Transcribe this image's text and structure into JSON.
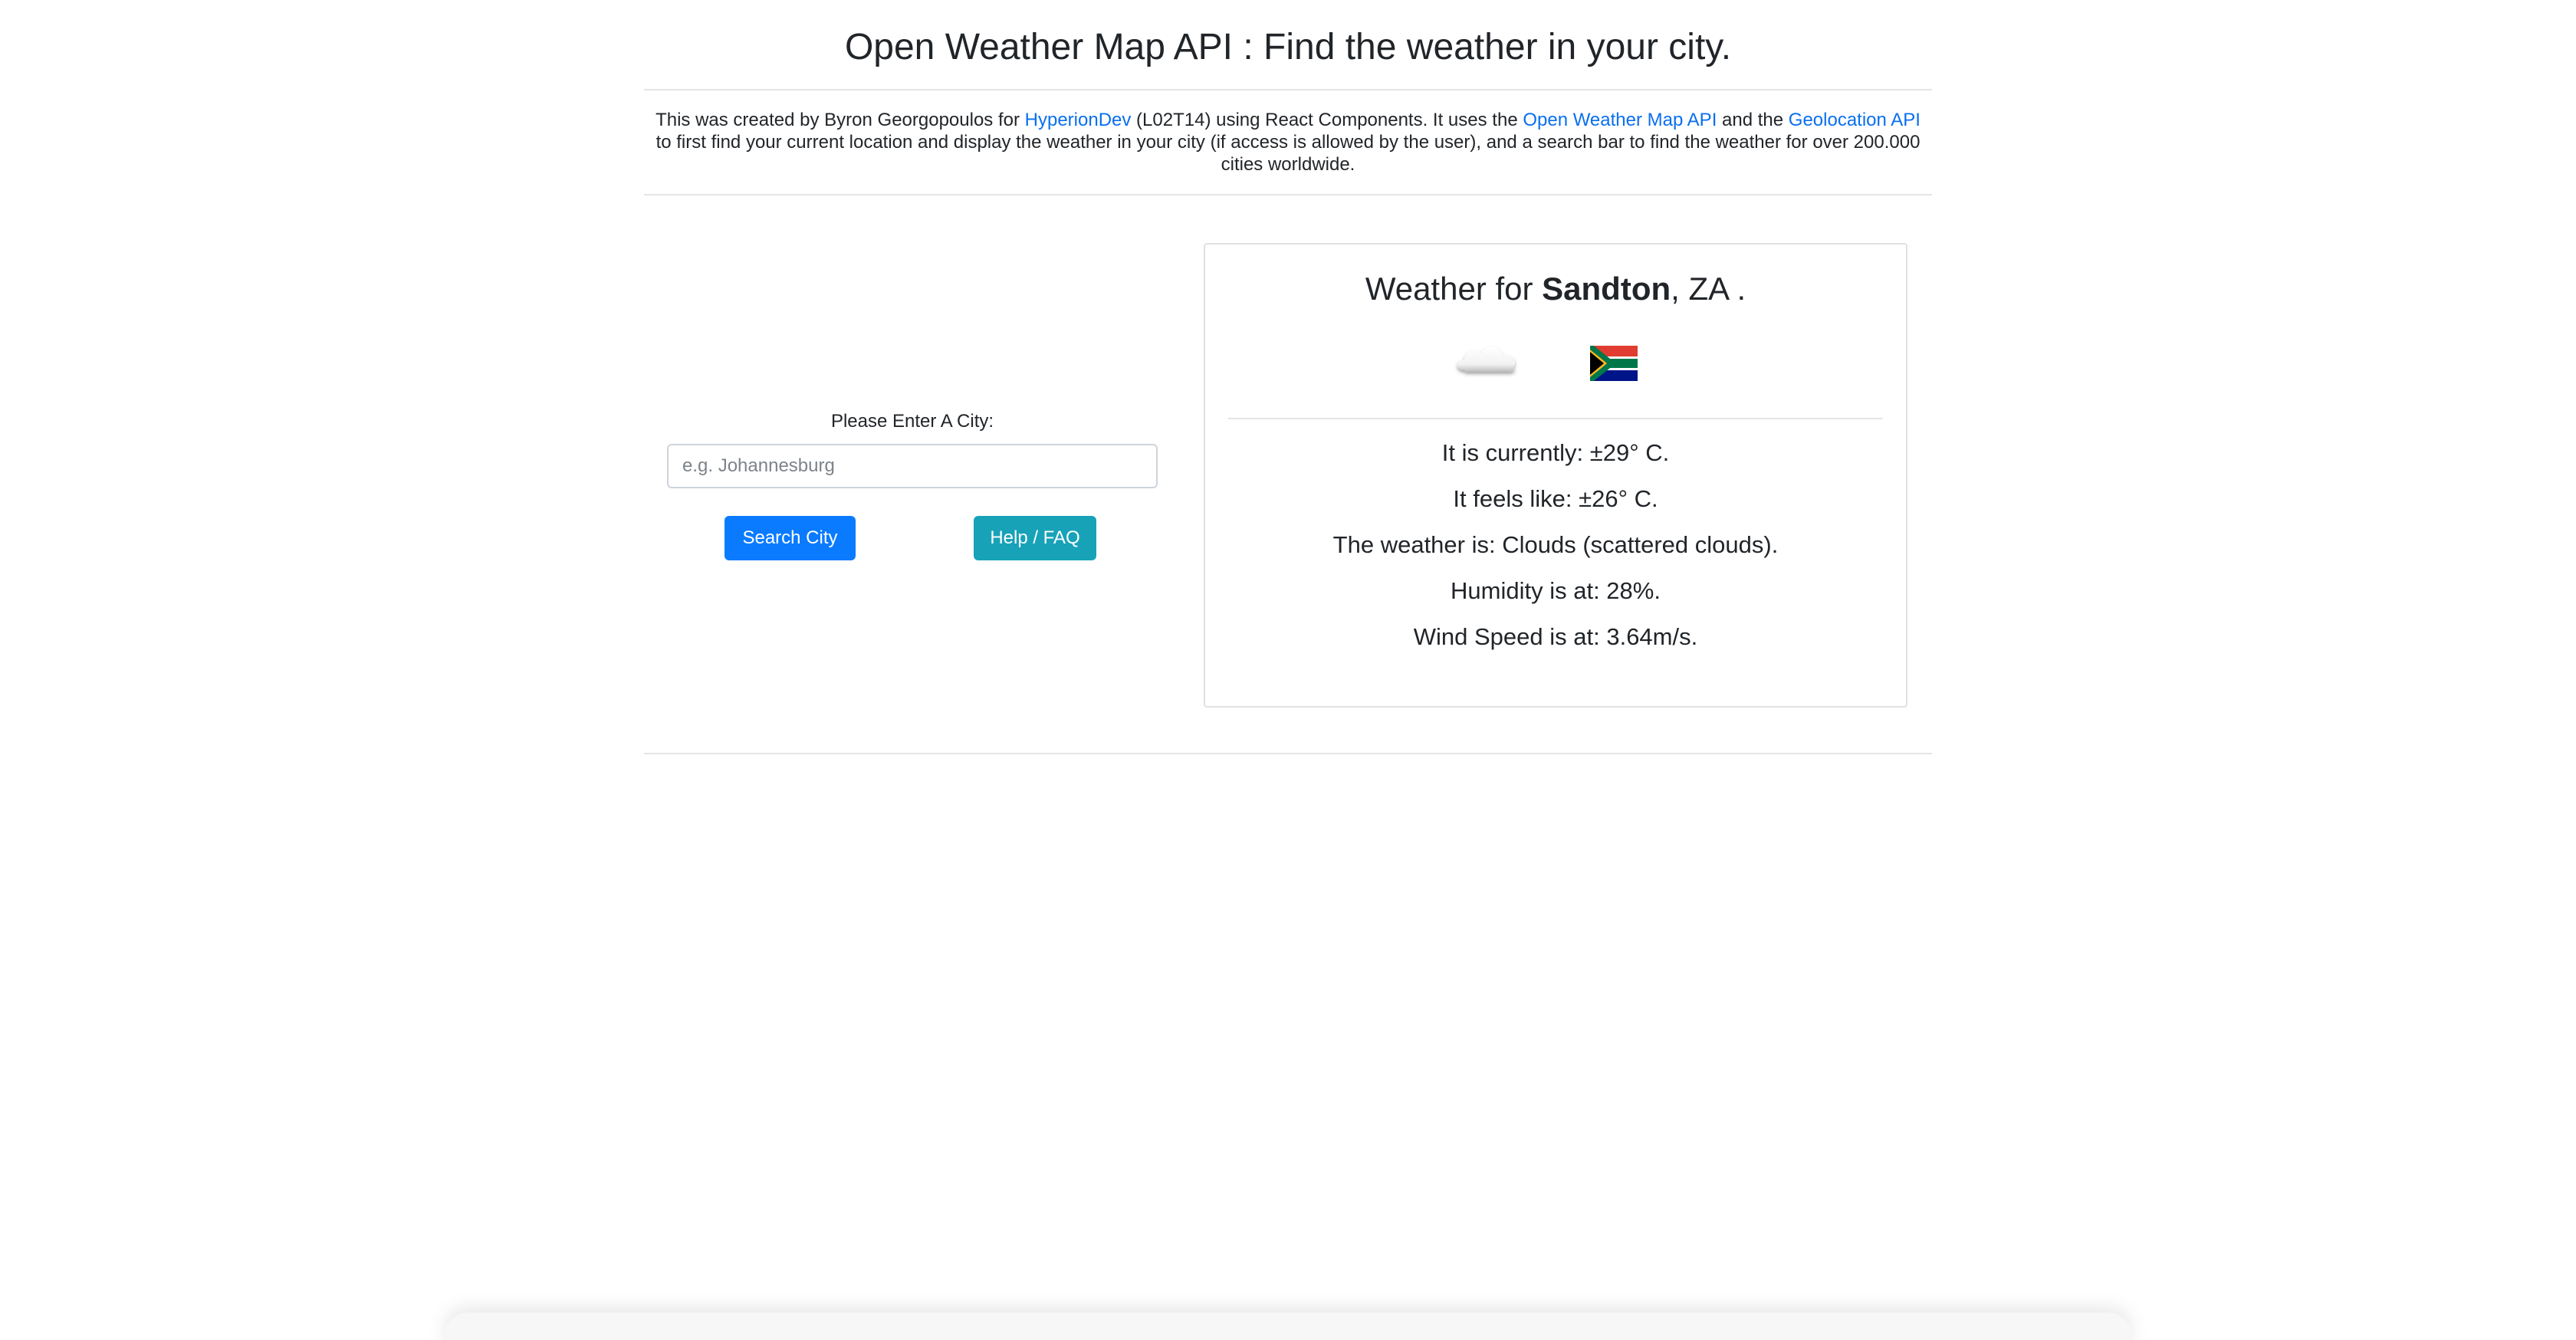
{
  "header": {
    "title": "Open Weather Map API : Find the weather in your city."
  },
  "intro": {
    "part1": "This was created by Byron Georgopoulos for ",
    "link_hyperiondev": "HyperionDev",
    "part2": " (L02T14) using React Components. It uses the ",
    "link_owm": "Open Weather Map API",
    "part3": " and the ",
    "link_geolocation": "Geolocation API",
    "part4": " to first find your current location and display the weather in your city (if access is allowed by the user), and a search bar to find the weather for over 200.000 cities worldwide."
  },
  "search": {
    "label": "Please Enter A City:",
    "placeholder": "e.g. Johannesburg",
    "value": "",
    "search_button": "Search City",
    "help_button": "Help / FAQ"
  },
  "weather": {
    "heading_prefix": "Weather for ",
    "city": "Sandton",
    "heading_suffix": ", ZA .",
    "weather_icon": "cloud-icon",
    "country_flag": "south-africa-flag",
    "currently": "It is currently: ±29° C.",
    "feels_like": "It feels like: ±26° C.",
    "description": "The weather is: Clouds (scattered clouds).",
    "humidity": "Humidity is at: 28%.",
    "wind": "Wind Speed is at: 3.64m/s."
  },
  "colors": {
    "link": "#0a6ff0",
    "primary_button": "#0a7bff",
    "info_button": "#17a2b8"
  }
}
